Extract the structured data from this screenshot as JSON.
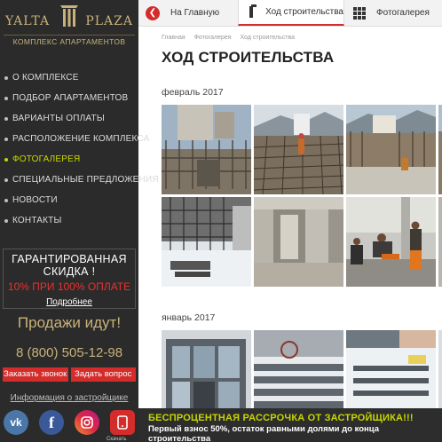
{
  "logo": {
    "left": "YALTA",
    "right": "PLAZA",
    "subtitle": "КОМПЛЕКС АПАРТАМЕНТОВ"
  },
  "nav": {
    "items": [
      {
        "label": "О КОМПЛЕКСЕ",
        "active": false
      },
      {
        "label": "ПОДБОР АПАРТАМЕНТОВ",
        "active": false
      },
      {
        "label": "ВАРИАНТЫ ОПЛАТЫ",
        "active": false
      },
      {
        "label": "РАСПОЛОЖЕНИЕ КОМПЛЕКСА",
        "active": false
      },
      {
        "label": "ФОТОГАЛЕРЕЯ",
        "active": true
      },
      {
        "label": "СПЕЦИАЛЬНЫЕ ПРЕДЛОЖЕНИЯ",
        "active": false
      },
      {
        "label": "НОВОСТИ",
        "active": false
      },
      {
        "label": "КОНТАКТЫ",
        "active": false
      }
    ]
  },
  "promo": {
    "title": "ГАРАНТИРОВАННАЯ СКИДКА !",
    "offer": "10% ПРИ 100% ОПЛАТЕ",
    "link": "Подробнее"
  },
  "sales": "Продажи идут!",
  "phone": "8 (800) 505-12-98",
  "buttons": {
    "call": "Заказать звонок",
    "ask": "Задать вопрос"
  },
  "developer_info": "Информация о застройщике",
  "social": {
    "vk": "vk",
    "fb": "f",
    "download_caption": "Скачать"
  },
  "topbar": {
    "home": "На Главную",
    "progress": "Ход строительства",
    "gallery": "Фотогалерея"
  },
  "breadcrumb": [
    "Главная",
    "Фотогалерея",
    "Ход строительства"
  ],
  "page_title": "ХОД СТРОИТЕЛЬСТВА",
  "months": [
    "февраль 2017",
    "январь 2017"
  ],
  "banner": {
    "title": "БЕСПРОЦЕНТНАЯ РАССРОЧКА ОТ ЗАСТРОЙЩИКА!!!",
    "text": "Первый взнос 50%, остаток равными долями до конца строительства"
  },
  "colors": {
    "accent_red": "#d42b2b",
    "accent_lime": "#c6d600",
    "gold": "#c9b27a",
    "sidebar_bg": "#2b2b2b"
  }
}
